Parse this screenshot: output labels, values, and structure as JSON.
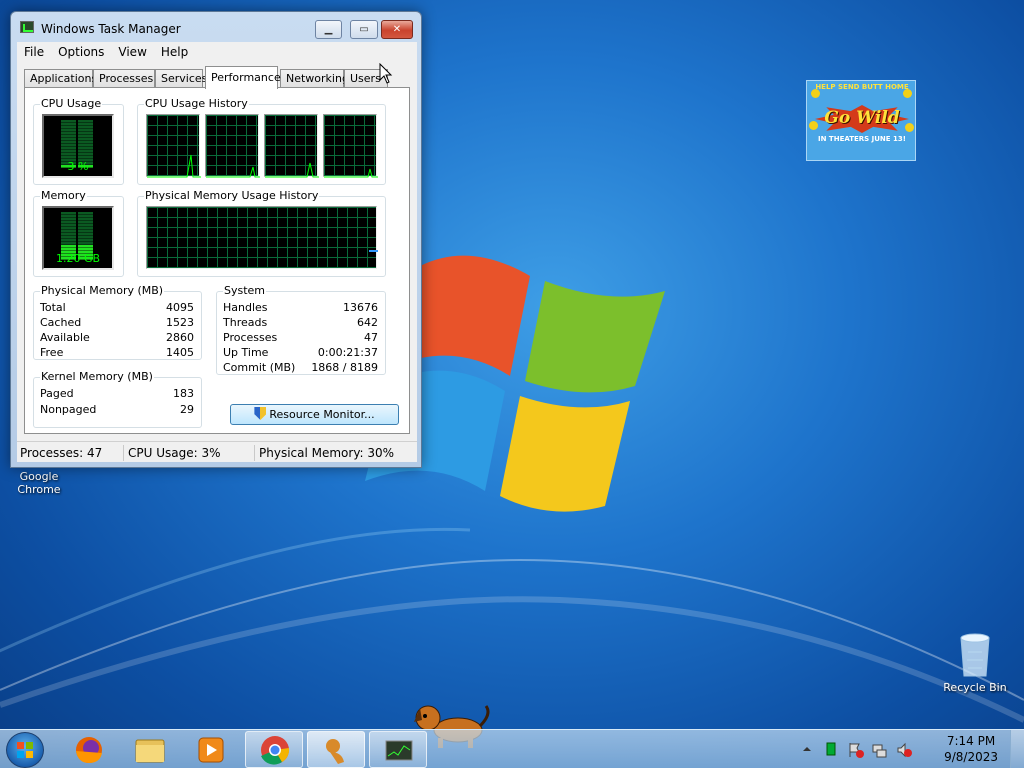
{
  "window": {
    "title": "Windows Task Manager",
    "minimize": "▁",
    "maximize": "▭",
    "close": "✕"
  },
  "menu": [
    "File",
    "Options",
    "View",
    "Help"
  ],
  "tabs": [
    "Applications",
    "Processes",
    "Services",
    "Performance",
    "Networking",
    "Users"
  ],
  "active_tab": "Performance",
  "cpu": {
    "label": "CPU Usage",
    "value": "3 %",
    "percent": 3
  },
  "cpu_history": {
    "label": "CPU Usage History",
    "cores": 4
  },
  "memory": {
    "label": "Memory",
    "value": "1.20 GB",
    "percent": 30
  },
  "mem_history": {
    "label": "Physical Memory Usage History"
  },
  "physical_memory": {
    "label": "Physical Memory (MB)",
    "rows": [
      {
        "k": "Total",
        "v": "4095"
      },
      {
        "k": "Cached",
        "v": "1523"
      },
      {
        "k": "Available",
        "v": "2860"
      },
      {
        "k": "Free",
        "v": "1405"
      }
    ]
  },
  "system": {
    "label": "System",
    "rows": [
      {
        "k": "Handles",
        "v": "13676"
      },
      {
        "k": "Threads",
        "v": "642"
      },
      {
        "k": "Processes",
        "v": "47"
      },
      {
        "k": "Up Time",
        "v": "0:00:21:37"
      },
      {
        "k": "Commit (MB)",
        "v": "1868 / 8189"
      }
    ]
  },
  "kernel_memory": {
    "label": "Kernel Memory (MB)",
    "rows": [
      {
        "k": "Paged",
        "v": "183"
      },
      {
        "k": "Nonpaged",
        "v": "29"
      }
    ]
  },
  "resource_monitor_button": "Resource Monitor...",
  "status": {
    "processes": "Processes: 47",
    "cpu": "CPU Usage: 3%",
    "memory": "Physical Memory: 30%"
  },
  "desktop": {
    "chrome_label_1": "Google",
    "chrome_label_2": "Chrome",
    "recycle_bin": "Recycle Bin",
    "ad": {
      "top": "HELP SEND BUTT HOME",
      "headline": "Go Wild",
      "sub": "IN THEATERS JUNE 13!"
    }
  },
  "taskbar": {
    "pinned": [
      "start-button",
      "firefox",
      "explorer",
      "media-player",
      "chrome",
      "bonzi-app",
      "task-manager"
    ]
  },
  "clock": {
    "time": "7:14 PM",
    "date": "9/8/2023"
  }
}
